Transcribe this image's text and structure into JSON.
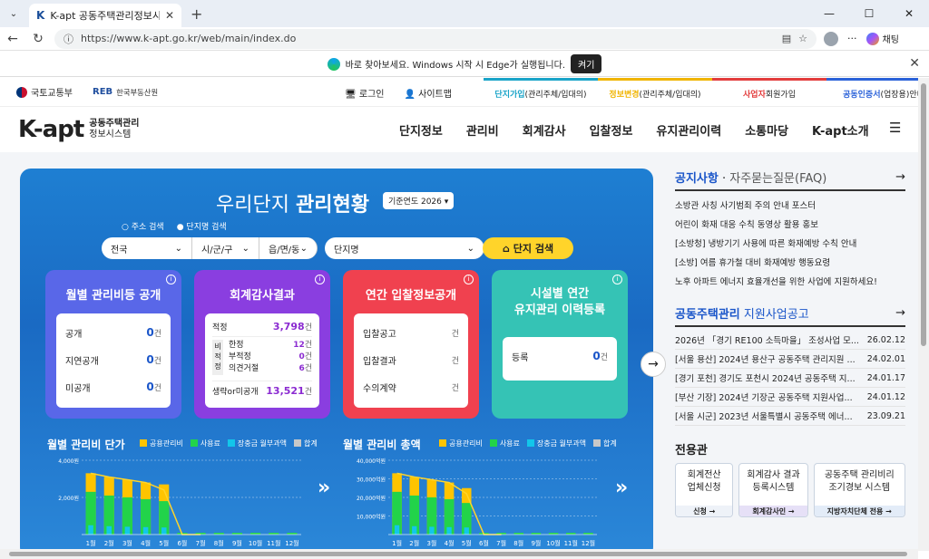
{
  "browser": {
    "tab_title": "K-apt 공동주택관리정보시스템",
    "tab_favicon": "K",
    "url": "https://www.k-apt.go.kr/web/main/index.do",
    "copilot_label": "채팅",
    "infobar_text": "바로 찾아보세요. Windows 시작 시 Edge가 실행됩니다.",
    "infobar_button": "켜기"
  },
  "util": {
    "gov": "국토교통부",
    "reb_brand": "REB",
    "reb_name": "한국부동산원",
    "login": "로그인",
    "sitemap": "사이트맵",
    "links": [
      {
        "hl": "단지가입",
        "rest": "(관리주체/입대의)",
        "color": "#19a4c8"
      },
      {
        "hl": "정보변경",
        "rest": "(관리주체/입대의)",
        "color": "#f0b400"
      },
      {
        "hl": "사업자",
        "rest": " 회원가입",
        "color": "#e23c3c"
      },
      {
        "hl": "공동인증서",
        "rest": " (업장용)안내",
        "color": "#2b62d9"
      }
    ]
  },
  "nav": {
    "logo_k": "K-apt",
    "logo_line1": "공동주택관리",
    "logo_line2": "정보시스템",
    "items": [
      "단지정보",
      "관리비",
      "회계감사",
      "입찰정보",
      "유지관리이력",
      "소통마당",
      "K-apt소개"
    ]
  },
  "panel": {
    "title_light": "우리단지 ",
    "title_bold": "관리현황",
    "year": "기준연도 2026",
    "radio1": "주소 검색",
    "radio2": "단지명 검색",
    "sel_sido": "전국",
    "sel_sigungu": "시/군/구",
    "sel_dong": "읍/면/동",
    "sel_name": "단지명",
    "search_btn": "단지 검색",
    "card1": {
      "title": "월별 관리비등 공개",
      "rows": [
        {
          "label": "공개",
          "val": "0",
          "unit": "건"
        },
        {
          "label": "지연공개",
          "val": "0",
          "unit": "건"
        },
        {
          "label": "미공개",
          "val": "0",
          "unit": "건"
        }
      ]
    },
    "card2": {
      "title": "회계감사결과",
      "r1l": "적정",
      "r1v": "3,798",
      "side": "비적정",
      "r2l": "한정",
      "r2v": "12",
      "r3l": "부적정",
      "r3v": "0",
      "r4l": "의견거절",
      "r4v": "6",
      "r5l": "생략or미공개",
      "r5v": "13,521",
      "unit": "건"
    },
    "card3": {
      "title": "연간 입찰정보공개",
      "rows": [
        {
          "label": "입찰공고",
          "unit": "건"
        },
        {
          "label": "입찰결과",
          "unit": "건"
        },
        {
          "label": "수의계약",
          "unit": "건"
        }
      ]
    },
    "card4": {
      "title1": "시설별 연간",
      "title2": "유지관리 이력등록",
      "label": "등록",
      "val": "0",
      "unit": "건"
    },
    "chart1_title": "월별 관리비 단가",
    "chart2_title": "월별 관리비 총액",
    "legend": [
      {
        "name": "공용관리비",
        "color": "#ffc400"
      },
      {
        "name": "사용료",
        "color": "#22d34a"
      },
      {
        "name": "장충금 월부과액",
        "color": "#13c6ea"
      },
      {
        "name": "합계",
        "color": "#c8c8c8"
      }
    ]
  },
  "chart_data": [
    {
      "type": "bar",
      "title": "월별 관리비 단가",
      "categories": [
        "1월",
        "2월",
        "3월",
        "4월",
        "5월",
        "6월",
        "7월",
        "8월",
        "9월",
        "10월",
        "11월",
        "12월"
      ],
      "y_ticks": [
        "4,000원",
        "2,000원"
      ],
      "ylim": [
        0,
        4000
      ],
      "series": [
        {
          "name": "공용관리비",
          "values": [
            3300,
            3100,
            2950,
            2800,
            2700,
            0,
            0,
            0,
            0,
            0,
            0,
            0
          ]
        },
        {
          "name": "사용료",
          "values": [
            2300,
            2100,
            2000,
            1900,
            1800,
            0,
            0,
            0,
            0,
            0,
            0,
            0
          ]
        },
        {
          "name": "장충금 월부과액",
          "values": [
            500,
            450,
            420,
            400,
            380,
            0,
            0,
            0,
            0,
            0,
            0,
            0
          ]
        },
        {
          "name": "합계",
          "values": [
            3300,
            3100,
            2950,
            2800,
            2400,
            0,
            0,
            0,
            0,
            0,
            0,
            0
          ]
        }
      ]
    },
    {
      "type": "bar",
      "title": "월별 관리비 총액",
      "categories": [
        "1월",
        "2월",
        "3월",
        "4월",
        "5월",
        "6월",
        "7월",
        "8월",
        "9월",
        "10월",
        "11월",
        "12월"
      ],
      "y_ticks": [
        "40,000억원",
        "30,000억원",
        "20,000억원",
        "10,000억원"
      ],
      "ylim": [
        0,
        40000
      ],
      "series": [
        {
          "name": "공용관리비",
          "values": [
            33000,
            31000,
            29500,
            28000,
            25000,
            0,
            0,
            0,
            0,
            0,
            0,
            0
          ]
        },
        {
          "name": "사용료",
          "values": [
            23000,
            21000,
            20000,
            19000,
            17000,
            0,
            0,
            0,
            0,
            0,
            0,
            0
          ]
        },
        {
          "name": "장충금 월부과액",
          "values": [
            5000,
            4500,
            4200,
            4000,
            3800,
            0,
            0,
            0,
            0,
            0,
            0,
            0
          ]
        },
        {
          "name": "합계",
          "values": [
            33000,
            31000,
            29500,
            28000,
            22000,
            0,
            0,
            0,
            0,
            0,
            0,
            0
          ]
        }
      ]
    }
  ],
  "notice": {
    "tab1": "공지사항",
    "tab2": "자주묻는질문(FAQ)",
    "items": [
      "소방관 사칭 사기범죄 주의 안내 포스터",
      "어린이 화재 대응 수칙 동영상 활용 홍보",
      "[소방청] 냉방기기 사용에 따른 화재예방 수칙 안내",
      "[소방] 여름 휴가철 대비 화재예방 행동요령",
      "노후 아파트 에너지 효율개선을 위한 사업에 지원하세요!"
    ]
  },
  "support": {
    "title_a": "공동주택관리",
    "title_b": " 지원사업공고",
    "items": [
      {
        "text": "2026년 「경기 RE100 소득마을」 조성사업 모...",
        "date": "26.02.12"
      },
      {
        "text": "[서울 용산] 2024년 용산구 공동주택 관리지원 ...",
        "date": "24.02.01"
      },
      {
        "text": "[경기 포천] 경기도 포천시 2024년 공동주택 지...",
        "date": "24.01.17"
      },
      {
        "text": "[부산 기장] 2024년 기장군 공동주택 지원사업...",
        "date": "24.01.12"
      },
      {
        "text": "[서울 시군] 2023년 서울특별시 공동주택 에너...",
        "date": "23.09.21"
      }
    ]
  },
  "dedicated": {
    "title": "전용관",
    "cards": [
      {
        "l1": "회계전산",
        "l2": "업체신청",
        "link": "신청 →"
      },
      {
        "l1": "회계감사 결과",
        "l2": "등록시스템",
        "link": "회계감사인 →"
      },
      {
        "l1": "공동주택 관리비리",
        "l2": "조기경보 시스템",
        "link": "지방자치단체 전용 →"
      }
    ]
  }
}
